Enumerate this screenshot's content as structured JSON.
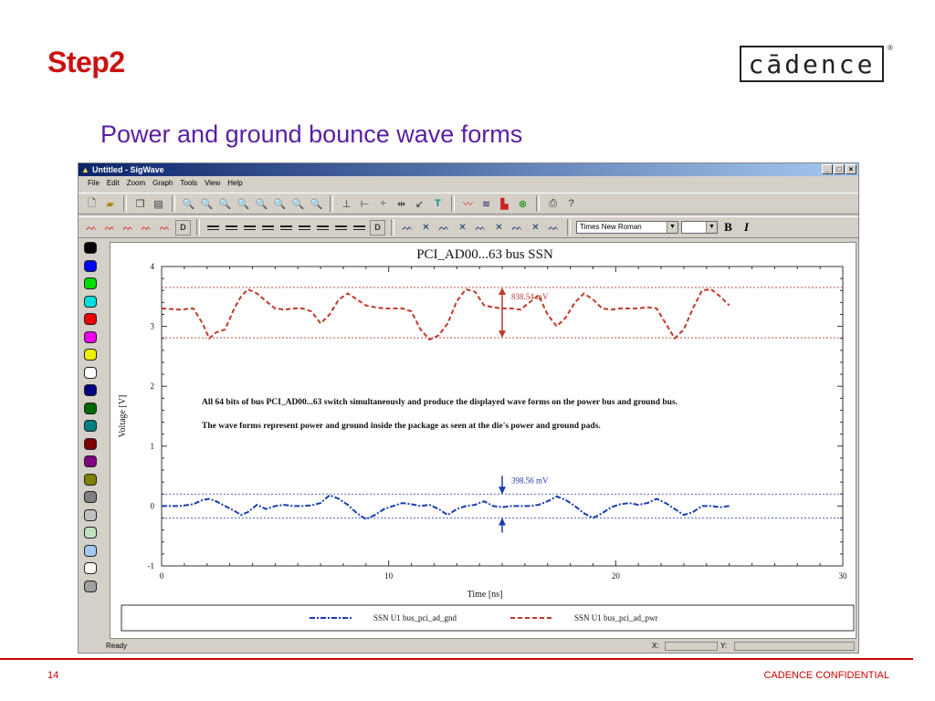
{
  "slide": {
    "title": "Step2",
    "subtitle": "Power and ground bounce wave forms",
    "logo_text": "cādence",
    "logo_reg": "®",
    "page_number": "14",
    "footer_text": "CADENCE CONFIDENTIAL"
  },
  "window": {
    "title": "Untitled - SigWave",
    "controls": [
      "_",
      "□",
      "×"
    ],
    "menu": [
      "File",
      "Edit",
      "Zoom",
      "Graph",
      "Tools",
      "View",
      "Help"
    ],
    "font_name": "Times New Roman",
    "bold_label": "B",
    "italic_label": "I",
    "status": {
      "text": "Ready",
      "x_label": "X:",
      "y_label": "Y:"
    }
  },
  "palette": [
    "#000000",
    "#0000ff",
    "#00dd00",
    "#00dddd",
    "#ee0000",
    "#ee00ee",
    "#eeee00",
    "#ffffff",
    "#000080",
    "#006600",
    "#008080",
    "#800000",
    "#800080",
    "#808000",
    "#808080",
    "#c0c0c0",
    "#c0e0c0",
    "#a0c8f0",
    "#fffff0",
    "#a0a0a0"
  ],
  "chart_data": {
    "type": "line",
    "title": "PCI_AD00...63 bus SSN",
    "xlabel": "Time [ns]",
    "ylabel": "Voltage [V]",
    "xlim": [
      0,
      30
    ],
    "ylim": [
      -1,
      4
    ],
    "x_ticks": [
      "0",
      "10",
      "20",
      "30"
    ],
    "y_ticks": [
      "-1",
      "0",
      "1",
      "2",
      "3",
      "4"
    ],
    "grid": false,
    "legend_position": "bottom",
    "annotation_lines": [
      "All 64 bits of bus PCI_AD00...63 switch simultaneously and produce the displayed wave forms on the power bus and ground bus.",
      "The wave forms represent power and ground inside the package as seen at the die's power and ground pads."
    ],
    "measurements": [
      {
        "label": "838.54 mV",
        "x": 15,
        "y_top": 3.65,
        "y_bottom": 2.81,
        "color": "#c0392b"
      },
      {
        "label": "398.56 mV",
        "x": 15,
        "y_top": 0.2,
        "y_bottom": -0.2,
        "color": "#1a3cb0"
      }
    ],
    "reference_lines": [
      {
        "y": 3.65,
        "color": "#c0392b"
      },
      {
        "y": 2.81,
        "color": "#c0392b"
      },
      {
        "y": 0.2,
        "color": "#1a3cb0"
      },
      {
        "y": -0.2,
        "color": "#1a3cb0"
      }
    ],
    "series": [
      {
        "name": "SSN U1 bus_pci_ad_gnd",
        "color": "#1a3cb0",
        "dash": "dashdot",
        "x": [
          0,
          0.8,
          1.4,
          1.8,
          2.1,
          2.4,
          2.8,
          3.2,
          3.5,
          3.8,
          4.2,
          4.6,
          5.0,
          5.4,
          5.8,
          6.2,
          6.6,
          7.0,
          7.4,
          7.8,
          8.2,
          8.6,
          9.0,
          9.4,
          9.8,
          10.2,
          10.6,
          11.0,
          11.4,
          11.8,
          12.2,
          12.6,
          13.0,
          13.4,
          13.8,
          14.2,
          14.6,
          15.0,
          15.4,
          15.8,
          16.2,
          16.6,
          17.0,
          17.4,
          17.8,
          18.2,
          18.6,
          19.0,
          19.4,
          19.8,
          20.2,
          20.6,
          21.0,
          21.4,
          21.8,
          22.2,
          22.6,
          23.0,
          23.4,
          23.8,
          24.2,
          24.6,
          25.0
        ],
        "y": [
          0.0,
          0.0,
          0.03,
          0.1,
          0.12,
          0.08,
          0.0,
          -0.08,
          -0.15,
          -0.1,
          0.02,
          -0.05,
          0.0,
          0.02,
          0.0,
          0.0,
          0.01,
          0.05,
          0.18,
          0.12,
          0.02,
          -0.12,
          -0.22,
          -0.15,
          -0.05,
          0.0,
          0.05,
          0.03,
          0.0,
          0.02,
          -0.05,
          -0.15,
          -0.05,
          0.0,
          0.02,
          0.08,
          0.0,
          -0.02,
          0.0,
          0.0,
          0.0,
          0.02,
          0.08,
          0.16,
          0.1,
          0.0,
          -0.12,
          -0.2,
          -0.12,
          -0.02,
          0.03,
          0.05,
          0.02,
          0.05,
          0.12,
          0.05,
          -0.05,
          -0.15,
          -0.1,
          0.0,
          0.0,
          -0.02,
          0.0
        ]
      },
      {
        "name": "SSN U1 bus_pci_ad_pwr",
        "color": "#c0392b",
        "dash": "dashed",
        "x": [
          0,
          0.8,
          1.4,
          1.8,
          2.1,
          2.4,
          2.8,
          3.2,
          3.5,
          3.8,
          4.2,
          4.6,
          5.0,
          5.4,
          5.8,
          6.2,
          6.6,
          7.0,
          7.4,
          7.8,
          8.2,
          8.6,
          9.0,
          9.4,
          9.8,
          10.2,
          10.6,
          11.0,
          11.4,
          11.8,
          12.2,
          12.6,
          13.0,
          13.4,
          13.8,
          14.2,
          14.6,
          15.0,
          15.4,
          15.8,
          16.2,
          16.6,
          17.0,
          17.4,
          17.8,
          18.2,
          18.6,
          19.0,
          19.4,
          19.8,
          20.2,
          20.6,
          21.0,
          21.4,
          21.8,
          22.2,
          22.6,
          23.0,
          23.4,
          23.8,
          24.2,
          24.6,
          25.0
        ],
        "y": [
          3.3,
          3.28,
          3.3,
          3.05,
          2.8,
          2.9,
          2.95,
          3.3,
          3.5,
          3.62,
          3.55,
          3.42,
          3.3,
          3.28,
          3.3,
          3.3,
          3.25,
          3.05,
          3.2,
          3.45,
          3.55,
          3.45,
          3.35,
          3.32,
          3.3,
          3.3,
          3.3,
          3.25,
          2.95,
          2.78,
          2.85,
          3.05,
          3.42,
          3.62,
          3.58,
          3.35,
          3.32,
          3.3,
          3.3,
          3.28,
          3.4,
          3.52,
          3.2,
          3.0,
          3.15,
          3.4,
          3.55,
          3.45,
          3.3,
          3.28,
          3.3,
          3.3,
          3.3,
          3.32,
          3.3,
          3.05,
          2.8,
          2.95,
          3.3,
          3.6,
          3.62,
          3.5,
          3.35
        ]
      }
    ]
  }
}
